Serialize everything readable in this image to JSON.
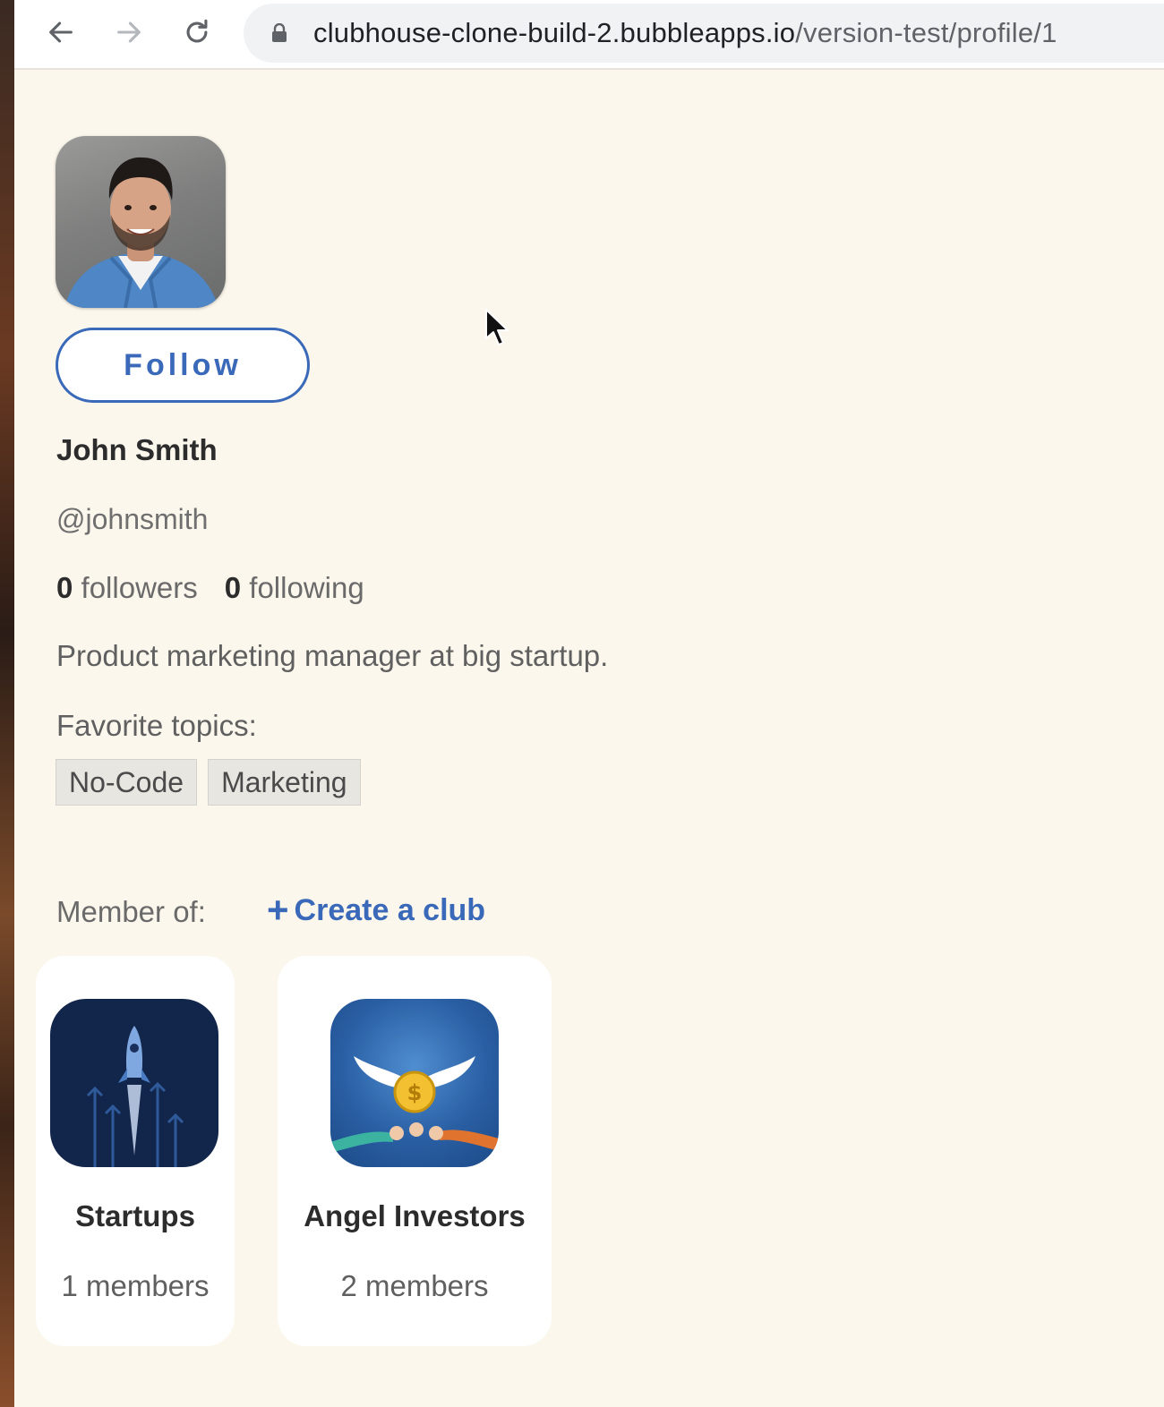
{
  "browser": {
    "url_domain": "clubhouse-clone-build-2.bubbleapps.io",
    "url_path": "/version-test/profile/1"
  },
  "profile": {
    "follow_label": "Follow",
    "name": "John Smith",
    "handle": "@johnsmith",
    "followers_count": "0",
    "followers_label": "followers",
    "following_count": "0",
    "following_label": "following",
    "bio": "Product marketing manager at big startup.",
    "favorite_topics_label": "Favorite topics:",
    "topics": [
      "No-Code",
      "Marketing"
    ]
  },
  "clubs": {
    "member_of_label": "Member of:",
    "create_plus": "+",
    "create_label": "Create a club",
    "items": [
      {
        "name": "Startups",
        "members": "1 members"
      },
      {
        "name": "Angel Investors",
        "members": "2 members"
      }
    ]
  },
  "colors": {
    "accent": "#3a69b9",
    "page_bg": "#fcf7ec"
  }
}
